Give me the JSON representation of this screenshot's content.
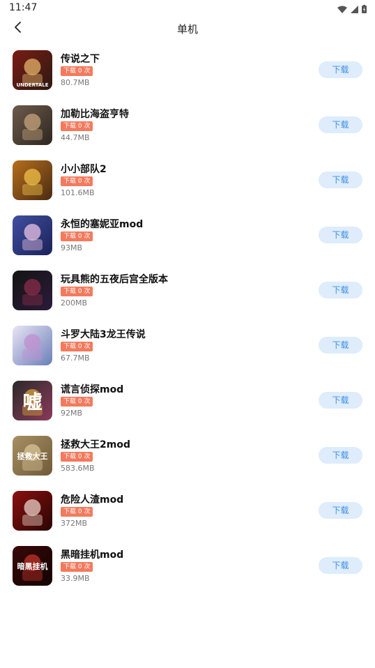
{
  "status_bar": {
    "time": "11:47"
  },
  "header": {
    "title": "单机",
    "back_icon": "chevron-left-icon"
  },
  "items": [
    {
      "name": "传说之下",
      "badge": "下载 0 次",
      "size": "80.7MB",
      "button": "下载",
      "thumb_text": "UNDERTALE",
      "colors": [
        "#7a1c14",
        "#e4b36a",
        "#2b1a12"
      ]
    },
    {
      "name": "加勒比海盗亨特",
      "badge": "下载 0 次",
      "size": "44.7MB",
      "button": "下载",
      "thumb_text": "",
      "colors": [
        "#6d5b4c",
        "#c5a47c",
        "#2d2620"
      ]
    },
    {
      "name": "小小部队2",
      "badge": "下载 0 次",
      "size": "101.6MB",
      "button": "下载",
      "thumb_text": "",
      "colors": [
        "#b66f1d",
        "#f0c04a",
        "#4a2a12"
      ]
    },
    {
      "name": "永恒的塞妮亚mod",
      "badge": "下载 0 次",
      "size": "93MB",
      "button": "下载",
      "thumb_text": "",
      "colors": [
        "#3f4fa0",
        "#e9c3e4",
        "#1c2258"
      ]
    },
    {
      "name": "玩具熊的五夜后宫全版本",
      "badge": "下载 0 次",
      "size": "200MB",
      "button": "下载",
      "thumb_text": "",
      "colors": [
        "#141414",
        "#8a2d4a",
        "#2b1a3a"
      ]
    },
    {
      "name": "斗罗大陆3龙王传说",
      "badge": "下载 0 次",
      "size": "67.7MB",
      "button": "下载",
      "thumb_text": "",
      "colors": [
        "#e9e4f5",
        "#c08fd0",
        "#6a7fb8"
      ]
    },
    {
      "name": "谎言侦探mod",
      "badge": "下载 0 次",
      "size": "92MB",
      "button": "下载",
      "thumb_text": "嘘",
      "colors": [
        "#2a2a2a",
        "#d6a13a",
        "#8a3a5a"
      ]
    },
    {
      "name": "拯救大王2mod",
      "badge": "下载 0 次",
      "size": "583.6MB",
      "button": "下载",
      "thumb_text": "拯救大王",
      "colors": [
        "#a88f63",
        "#d8c49a",
        "#6f5a38"
      ]
    },
    {
      "name": "危险人渣mod",
      "badge": "下载 0 次",
      "size": "372MB",
      "button": "下载",
      "thumb_text": "",
      "colors": [
        "#8b0f0f",
        "#e8d0c4",
        "#2a0505"
      ]
    },
    {
      "name": "黑暗挂机mod",
      "badge": "下载 0 次",
      "size": "33.9MB",
      "button": "下载",
      "thumb_text": "暗黑挂机",
      "colors": [
        "#3a0808",
        "#c2342a",
        "#120303"
      ]
    }
  ]
}
